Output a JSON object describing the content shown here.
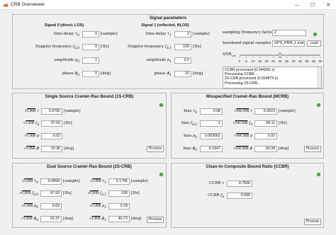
{
  "window": {
    "title": "CRB Overviewer",
    "minimize_glyph": "—",
    "maximize_glyph": "☐",
    "close_glyph": "✕"
  },
  "signal_params": {
    "title": "Signal parameters",
    "signal0": {
      "heading": "Signal 0 (direct, LOS)",
      "rows": [
        {
          "label": "time-delay τ₀",
          "value": "0",
          "unit": "[sample]"
        },
        {
          "label": "Doppler frequency f_d,0",
          "value": "0",
          "unit": "[Hz]"
        },
        {
          "label": "amplitude ρ₀",
          "value": "1",
          "unit": ""
        },
        {
          "label": "phase ϕ₀",
          "value": "0",
          "unit": "[deg]"
        }
      ]
    },
    "signal1": {
      "heading": "Signal 1 (reflected, NLOS)",
      "rows": [
        {
          "label": "time-delay τ₁",
          "value": "2",
          "unit": "[sample]"
        },
        {
          "label": "Doppler frequency f_d,1",
          "value": "100",
          "unit": "[Hz]"
        },
        {
          "label": "amplitude ρ₁",
          "value": "0.5",
          "unit": ""
        },
        {
          "label": "phase ϕ₁",
          "value": "15",
          "unit": "[deg]"
        }
      ]
    },
    "sampling": {
      "label": "sampling frequency factor",
      "value": "2"
    },
    "baseband": {
      "label": "baseband signal samples",
      "value": "GPS_PRN_1.mat",
      "button": "Load"
    },
    "snr": {
      "label": "SNR_out",
      "ticks": [
        "0",
        "5",
        "10",
        "15",
        "20",
        "25",
        "30",
        "35",
        "40",
        "45",
        "50",
        "55",
        "60"
      ],
      "value": 30,
      "min": 0,
      "max": 60
    },
    "log": [
      "CCBR processed (0.044341 s)",
      "Processing CCBR...",
      "2S-CRB processed (0.024875 s)",
      "Processing 2S-CRB..."
    ]
  },
  "crb_1s": {
    "title": "Single Source Cramér-Rao Bound (1S-CRB)",
    "rows": [
      {
        "param": "τ",
        "value": "0.0782",
        "unit": "[sample]"
      },
      {
        "param": "f_d",
        "value": "97.93",
        "unit": "[Hz]"
      },
      {
        "param": "ρ",
        "value": "0.02",
        "unit": ""
      },
      {
        "param": "ϕ",
        "value": "20.36",
        "unit": "[deg]"
      }
    ],
    "button": "Process"
  },
  "mcrb": {
    "title": "Misspecified Cramér-Rao Bound (MCRB)",
    "rows": [
      {
        "bias": "bias τ₀",
        "bias_value": "0.08",
        "param": "τ",
        "mcrb_value": "0.0823",
        "unit": "[sample]"
      },
      {
        "bias": "bias f_d,0",
        "bias_value": "-1",
        "param": "f_d",
        "mcrb_value": "98.11",
        "unit": "[Hz]"
      },
      {
        "bias": "bias ρ₀",
        "bias_value": "0.003081",
        "param": "ρ",
        "mcrb_value": "0.02",
        "unit": ""
      },
      {
        "bias": "bias ϕ₀",
        "bias_value": "-0.1847",
        "param": "ϕ",
        "mcrb_value": "20.34",
        "unit": "[deg]"
      }
    ],
    "button": "Process"
  },
  "crb_2s": {
    "title": "Dual Source Cramér-Rao Bound (2S-CRB)",
    "rows": [
      {
        "p0": "τ₀",
        "v0": "0.0899",
        "unit": "[sample]",
        "p1": "τ₁",
        "v1": "0.1795",
        "unit1": "[sample]"
      },
      {
        "p0": "f_d,0",
        "v0": "97.93",
        "unit": "[Hz]",
        "p1": "f_d,1",
        "v1": "196",
        "unit1": "[Hz]"
      },
      {
        "p0": "ρ₀",
        "v0": "0.09",
        "unit": "",
        "p1": "ρ₁",
        "v1": "0.18",
        "unit1": ""
      },
      {
        "p0": "ϕ₀",
        "v0": "20.37",
        "unit": "[deg]",
        "p1": "ϕ₁",
        "v1": "40.73",
        "unit1": "[deg]"
      }
    ],
    "button": "Process"
  },
  "ccbr": {
    "title": "Clean-to-Composite Bound Ratio (CCBR)",
    "rows": [
      {
        "label": "CCBR τ",
        "value": "0.7566"
      },
      {
        "label": "CCBR f_d",
        "value": "0.999"
      }
    ],
    "button": "Process"
  },
  "colors": {
    "led": "#3cc43c",
    "panel_bg": "#f0f0f0"
  }
}
